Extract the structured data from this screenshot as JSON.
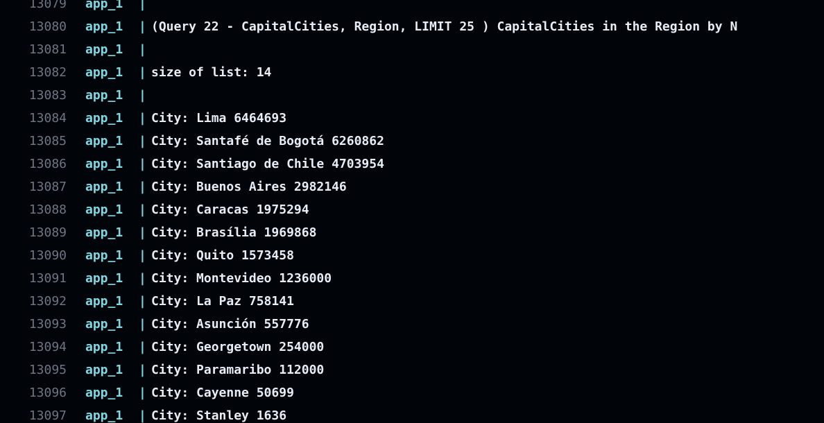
{
  "log": {
    "lines": [
      {
        "num": "13079",
        "source": "app_1",
        "sep": "|",
        "text": ""
      },
      {
        "num": "13080",
        "source": "app_1",
        "sep": "|",
        "text": "(Query 22 - CapitalCities, Region, LIMIT 25 ) CapitalCities in the Region by N"
      },
      {
        "num": "13081",
        "source": "app_1",
        "sep": "|",
        "text": ""
      },
      {
        "num": "13082",
        "source": "app_1",
        "sep": "|",
        "text": "size of list: 14"
      },
      {
        "num": "13083",
        "source": "app_1",
        "sep": "|",
        "text": ""
      },
      {
        "num": "13084",
        "source": "app_1",
        "sep": "|",
        "text": "City: Lima 6464693"
      },
      {
        "num": "13085",
        "source": "app_1",
        "sep": "|",
        "text": "City: Santafé de Bogotá 6260862"
      },
      {
        "num": "13086",
        "source": "app_1",
        "sep": "|",
        "text": "City: Santiago de Chile 4703954"
      },
      {
        "num": "13087",
        "source": "app_1",
        "sep": "|",
        "text": "City: Buenos Aires 2982146"
      },
      {
        "num": "13088",
        "source": "app_1",
        "sep": "|",
        "text": "City: Caracas 1975294"
      },
      {
        "num": "13089",
        "source": "app_1",
        "sep": "|",
        "text": "City: Brasília 1969868"
      },
      {
        "num": "13090",
        "source": "app_1",
        "sep": "|",
        "text": "City: Quito 1573458"
      },
      {
        "num": "13091",
        "source": "app_1",
        "sep": "|",
        "text": "City: Montevideo 1236000"
      },
      {
        "num": "13092",
        "source": "app_1",
        "sep": "|",
        "text": "City: La Paz 758141"
      },
      {
        "num": "13093",
        "source": "app_1",
        "sep": "|",
        "text": "City: Asunción 557776"
      },
      {
        "num": "13094",
        "source": "app_1",
        "sep": "|",
        "text": "City: Georgetown 254000"
      },
      {
        "num": "13095",
        "source": "app_1",
        "sep": "|",
        "text": "City: Paramaribo 112000"
      },
      {
        "num": "13096",
        "source": "app_1",
        "sep": "|",
        "text": "City: Cayenne 50699"
      },
      {
        "num": "13097",
        "source": "app_1",
        "sep": "|",
        "text": "City: Stanley 1636"
      }
    ]
  }
}
